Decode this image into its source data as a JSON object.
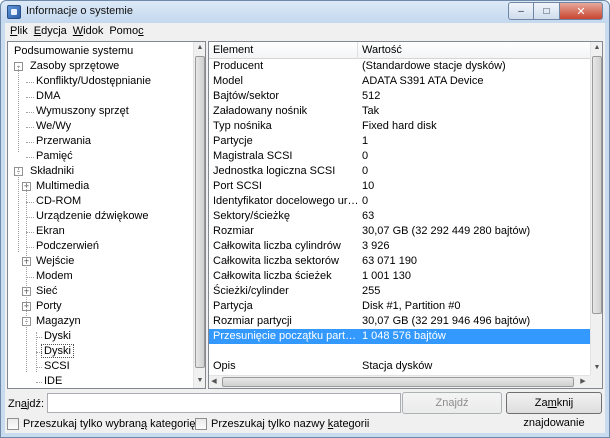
{
  "window": {
    "title": "Informacje o systemie",
    "controls": {
      "minimize": "–",
      "maximize": "□",
      "close": "✕"
    }
  },
  "menu": [
    {
      "pre": "",
      "key": "P",
      "post": "lik"
    },
    {
      "pre": "",
      "key": "E",
      "post": "dycja"
    },
    {
      "pre": "",
      "key": "W",
      "post": "idok"
    },
    {
      "pre": "Pomo",
      "key": "c",
      "post": ""
    }
  ],
  "tree": [
    {
      "label": "Podsumowanie systemu",
      "level": 0,
      "expander": null
    },
    {
      "label": "Zasoby sprzętowe",
      "level": 1,
      "expander": "-"
    },
    {
      "label": "Konflikty/Udostępnianie",
      "level": 2,
      "expander": null
    },
    {
      "label": "DMA",
      "level": 2,
      "expander": null
    },
    {
      "label": "Wymuszony sprzęt",
      "level": 2,
      "expander": null
    },
    {
      "label": "We/Wy",
      "level": 2,
      "expander": null
    },
    {
      "label": "Przerwania",
      "level": 2,
      "expander": null
    },
    {
      "label": "Pamięć",
      "level": 2,
      "expander": null
    },
    {
      "label": "Składniki",
      "level": 1,
      "expander": "-"
    },
    {
      "label": "Multimedia",
      "level": 2,
      "expander": "+"
    },
    {
      "label": "CD-ROM",
      "level": 2,
      "expander": null
    },
    {
      "label": "Urządzenie dźwiękowe",
      "level": 2,
      "expander": null
    },
    {
      "label": "Ekran",
      "level": 2,
      "expander": null
    },
    {
      "label": "Podczerwień",
      "level": 2,
      "expander": null
    },
    {
      "label": "Wejście",
      "level": 2,
      "expander": "+"
    },
    {
      "label": "Modem",
      "level": 2,
      "expander": null
    },
    {
      "label": "Sieć",
      "level": 2,
      "expander": "+"
    },
    {
      "label": "Porty",
      "level": 2,
      "expander": "+"
    },
    {
      "label": "Magazyn",
      "level": 2,
      "expander": "-"
    },
    {
      "label": "Dyski",
      "level": 3,
      "expander": null
    },
    {
      "label": "Dyski",
      "level": 3,
      "expander": null,
      "selected": true
    },
    {
      "label": "SCSI",
      "level": 3,
      "expander": null
    },
    {
      "label": "IDE",
      "level": 3,
      "expander": null
    }
  ],
  "details": {
    "columns": [
      "Element",
      "Wartość"
    ],
    "rows": [
      [
        "Producent",
        "(Standardowe stacje dysków)"
      ],
      [
        "Model",
        "ADATA S391 ATA Device"
      ],
      [
        "Bajtów/sektor",
        "512"
      ],
      [
        "Załadowany nośnik",
        "Tak"
      ],
      [
        "Typ nośnika",
        "Fixed hard disk"
      ],
      [
        "Partycje",
        "1"
      ],
      [
        "Magistrala SCSI",
        "0"
      ],
      [
        "Jednostka logiczna SCSI",
        "0"
      ],
      [
        "Port SCSI",
        "10"
      ],
      [
        "Identyfikator docelowego urzą...",
        "0"
      ],
      [
        "Sektory/ścieżkę",
        "63"
      ],
      [
        "Rozmiar",
        "30,07 GB (32 292 449 280 bajtów)"
      ],
      [
        "Całkowita liczba cylindrów",
        "3 926"
      ],
      [
        "Całkowita liczba sektorów",
        "63 071 190"
      ],
      [
        "Całkowita liczba ścieżek",
        "1 001 130"
      ],
      [
        "Ścieżki/cylinder",
        "255"
      ],
      [
        "Partycja",
        "Disk #1, Partition #0"
      ],
      [
        "Rozmiar partycji",
        "30,07 GB (32 291 946 496 bajtów)"
      ],
      [
        "Przesunięcie początku partycji",
        "1 048 576 bajtów"
      ],
      [
        "",
        ""
      ],
      [
        "Opis",
        "Stacja dysków"
      ]
    ],
    "selected_row": 18
  },
  "find": {
    "label_pre": "Zn",
    "label_key": "a",
    "label_post": "jdź:",
    "value": "",
    "find_button": "Znajdź",
    "close_pre": "Za",
    "close_key": "m",
    "close_post": "knij znajdowanie",
    "chk1_pre": "Przeszukaj tylko wybran",
    "chk1_key": "ą",
    "chk1_post": " kategorię",
    "chk2_pre": "Przeszukaj tylko nazwy ",
    "chk2_key": "k",
    "chk2_post": "ategorii"
  }
}
